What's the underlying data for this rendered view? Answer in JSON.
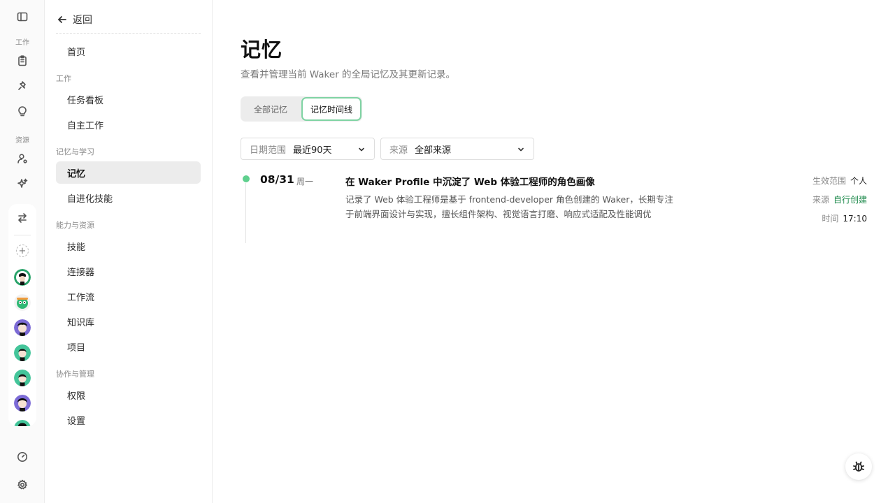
{
  "rail": {
    "section_work": "工作",
    "section_resources": "资源",
    "icons": [
      "sidebar-toggle-icon",
      "clipboard-icon",
      "pin-icon",
      "lightbulb-icon",
      "user-settings-icon",
      "sparkle-icon",
      "swap-icon",
      "add-icon",
      "gauge-icon",
      "gear-icon"
    ]
  },
  "sidebar": {
    "back_label": "返回",
    "home": "首页",
    "sections": {
      "work": "工作",
      "memory_learning": "记忆与学习",
      "capabilities": "能力与资源",
      "collab": "协作与管理"
    },
    "items": {
      "task_board": "任务看板",
      "autonomous_work": "自主工作",
      "memory": "记忆",
      "self_evolving_skills": "自进化技能",
      "skills": "技能",
      "connectors": "连接器",
      "workflows": "工作流",
      "knowledge_base": "知识库",
      "projects": "项目",
      "permissions": "权限",
      "settings": "设置"
    }
  },
  "main": {
    "title": "记忆",
    "subtitle": "查看并管理当前 Waker 的全局记忆及其更新记录。",
    "tabs": [
      "全部记忆",
      "记忆时间线"
    ],
    "active_tab": "记忆时间线",
    "filters": {
      "date_label": "日期范围",
      "date_value": "最近90天",
      "source_label": "来源",
      "source_value": "全部来源"
    },
    "timeline": [
      {
        "date": "08/31",
        "weekday": "周一",
        "title": "在 Waker Profile 中沉淀了 Web 体验工程师的角色画像",
        "description": "记录了 Web 体验工程师是基于 frontend-developer 角色创建的 Waker，长期专注于前端界面设计与实现，擅长组件架构、视觉语言打磨、响应式适配及性能调优",
        "scope_label": "生效范围",
        "scope_value": "个人",
        "source_label": "来源",
        "source_value": "自行创建",
        "time_label": "时间",
        "time_value": "17:10"
      }
    ]
  },
  "colors": {
    "accent_green": "#5fd08e",
    "tab_border": "#7fd3a3",
    "source_green": "#1e8a4c"
  }
}
